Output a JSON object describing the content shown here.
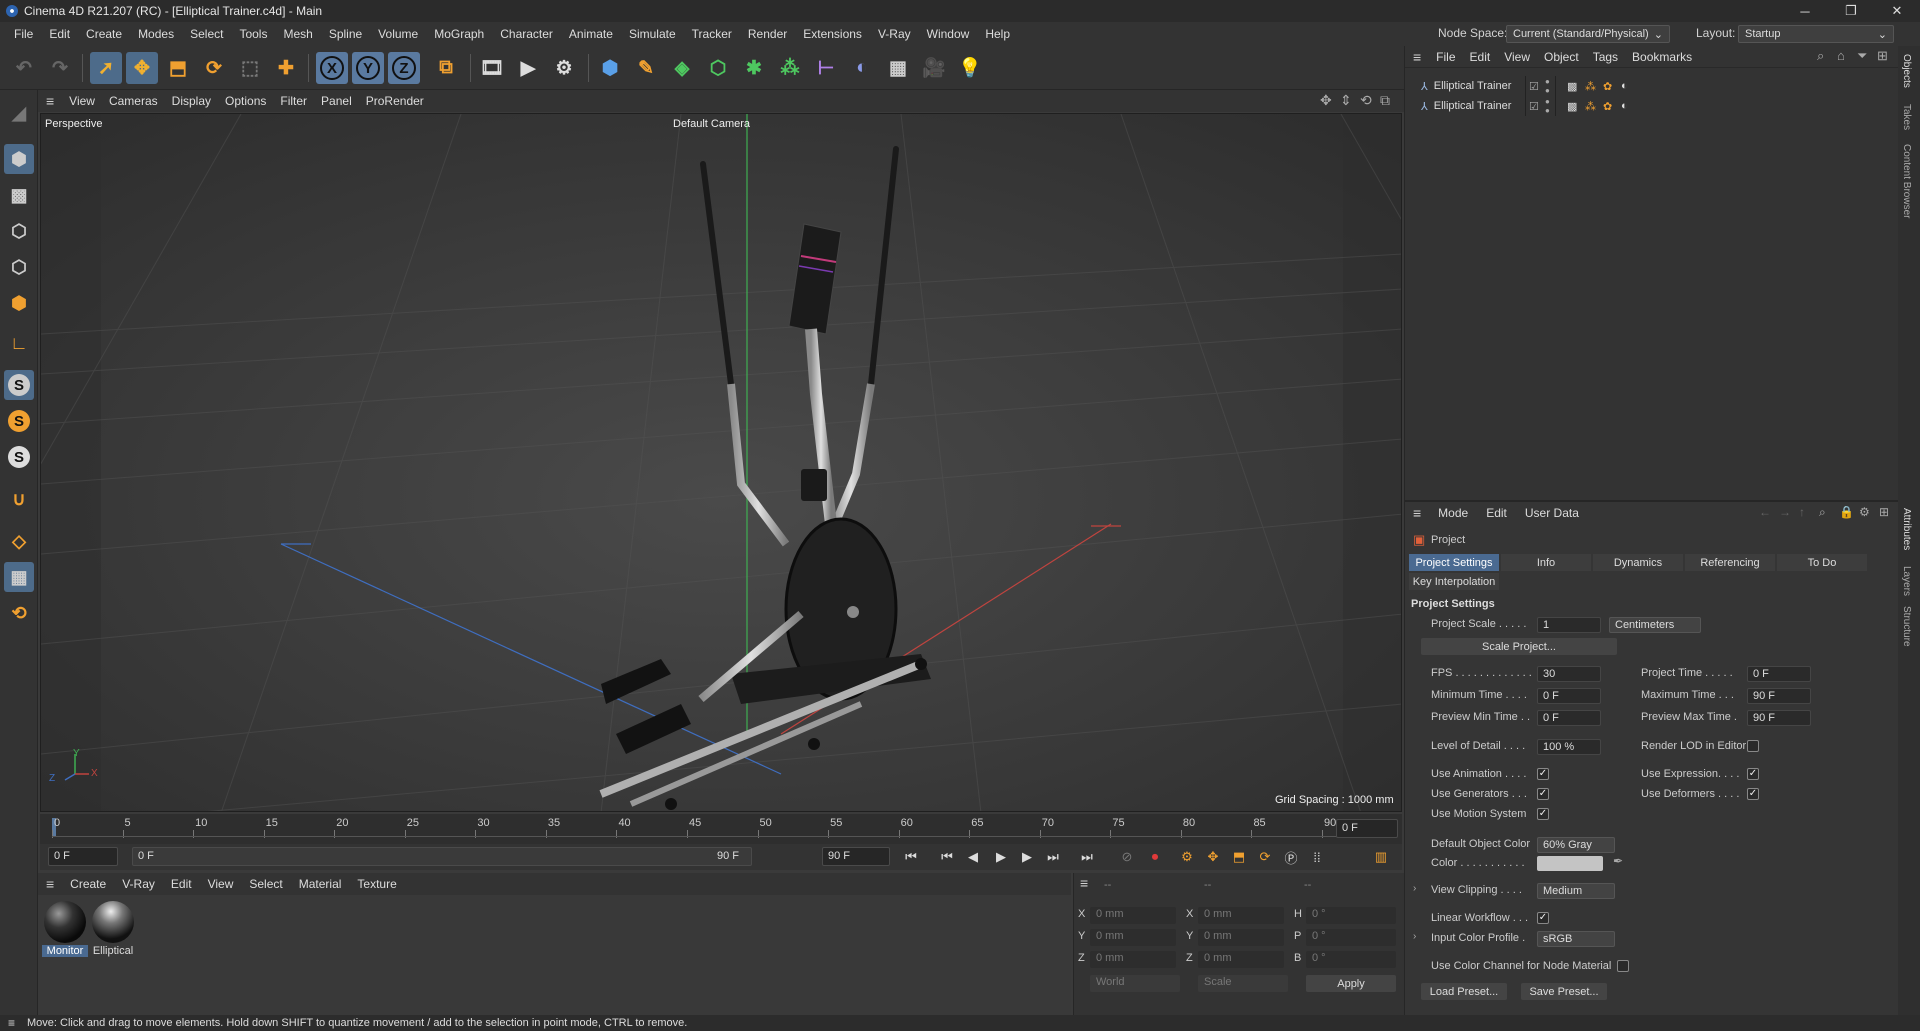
{
  "window": {
    "title": "Cinema 4D R21.207 (RC) - [Elliptical Trainer.c4d] - Main",
    "min": "─",
    "max": "❐",
    "close": "✕"
  },
  "menubar": {
    "items": [
      "File",
      "Edit",
      "Create",
      "Modes",
      "Select",
      "Tools",
      "Mesh",
      "Spline",
      "Volume",
      "MoGraph",
      "Character",
      "Animate",
      "Simulate",
      "Tracker",
      "Render",
      "Extensions",
      "V-Ray",
      "Window",
      "Help"
    ],
    "node_space_label": "Node Space:",
    "node_space_value": "Current (Standard/Physical)",
    "layout_label": "Layout:",
    "layout_value": "Startup"
  },
  "toolbar": {
    "axis_x": "X",
    "axis_y": "Y",
    "axis_z": "Z"
  },
  "viewport": {
    "menu": [
      "View",
      "Cameras",
      "Display",
      "Options",
      "Filter",
      "Panel",
      "ProRender"
    ],
    "label": "Perspective",
    "camera": "Default Camera",
    "grid_spacing": "Grid Spacing : 1000 mm",
    "axis_y": "Y",
    "axis_x": "X",
    "axis_z": "Z"
  },
  "timeline": {
    "ticks": [
      "0",
      "5",
      "10",
      "15",
      "20",
      "25",
      "30",
      "35",
      "40",
      "45",
      "50",
      "55",
      "60",
      "65",
      "70",
      "75",
      "80",
      "85",
      "90"
    ],
    "current": "0 F",
    "start": "0 F",
    "range_start": "0 F",
    "range_end": "90 F",
    "end": "90 F"
  },
  "materials": {
    "menu": [
      "Create",
      "V-Ray",
      "Edit",
      "View",
      "Select",
      "Material",
      "Texture"
    ],
    "items": [
      {
        "name": "Monitor"
      },
      {
        "name": "Elliptical"
      }
    ]
  },
  "coordinates": {
    "header": [
      "--",
      "--",
      "--"
    ],
    "rows": [
      {
        "a": "X",
        "av": "0 mm",
        "b": "X",
        "bv": "0 mm",
        "c": "H",
        "cv": "0 °"
      },
      {
        "a": "Y",
        "av": "0 mm",
        "b": "Y",
        "bv": "0 mm",
        "c": "P",
        "cv": "0 °"
      },
      {
        "a": "Z",
        "av": "0 mm",
        "b": "Z",
        "bv": "0 mm",
        "c": "B",
        "cv": "0 °"
      }
    ],
    "world": "World",
    "scale": "Scale",
    "apply": "Apply"
  },
  "status": "Move: Click and drag to move elements. Hold down SHIFT to quantize movement / add to the selection in point mode, CTRL to remove.",
  "objects": {
    "menu": [
      "File",
      "Edit",
      "View",
      "Object",
      "Tags",
      "Bookmarks"
    ],
    "rows": [
      {
        "name": "Elliptical Trainer"
      },
      {
        "name": "Elliptical Trainer"
      }
    ]
  },
  "attributes": {
    "menu": [
      "Mode",
      "Edit",
      "User Data"
    ],
    "title": "Project",
    "tabs": [
      "Project Settings",
      "Info",
      "Dynamics",
      "Referencing",
      "To Do"
    ],
    "tab2": "Key Interpolation",
    "section": "Project Settings",
    "project_scale_label": "Project Scale . . . . .",
    "project_scale_value": "1",
    "project_scale_unit": "Centimeters",
    "scale_project_btn": "Scale Project...",
    "fps_label": "FPS . . . . . . . . . . . . .",
    "fps_value": "30",
    "project_time_label": "Project Time . . . . .",
    "project_time_value": "0 F",
    "min_time_label": "Minimum Time . . . .",
    "min_time_value": "0 F",
    "max_time_label": "Maximum Time . . .",
    "max_time_value": "90 F",
    "prev_min_label": "Preview Min Time . .",
    "prev_min_value": "0 F",
    "prev_max_label": "Preview Max Time .",
    "prev_max_value": "90 F",
    "lod_label": "Level of Detail . . . .",
    "lod_value": "100 %",
    "render_lod_label": "Render LOD in Editor",
    "use_anim_label": "Use Animation . . . .",
    "use_expr_label": "Use Expression. . . .",
    "use_gen_label": "Use Generators . . .",
    "use_def_label": "Use Deformers . . . .",
    "use_motion_label": "Use Motion System",
    "def_obj_color_label": "Default Object Color",
    "def_obj_color_value": "60% Gray",
    "color_label": "Color . . . . . . . . . . .",
    "view_clip_label": "View Clipping . . . .",
    "view_clip_value": "Medium",
    "linear_wf_label": "Linear Workflow . . .",
    "input_cp_label": "Input Color Profile .",
    "input_cp_value": "sRGB",
    "color_channel_label": "Use Color Channel for Node Material",
    "load_preset": "Load Preset...",
    "save_preset": "Save Preset...",
    "check": "✓"
  },
  "side_tabs": {
    "objects": "Objects",
    "takes": "Takes",
    "content": "Content Browser",
    "attributes": "Attributes",
    "layers": "Layers",
    "structure": "Structure"
  },
  "colors": {
    "accent": "#4a6a91",
    "axis_x": "#c0443f",
    "axis_y": "#3fae52",
    "axis_z": "#3f6ec0"
  }
}
